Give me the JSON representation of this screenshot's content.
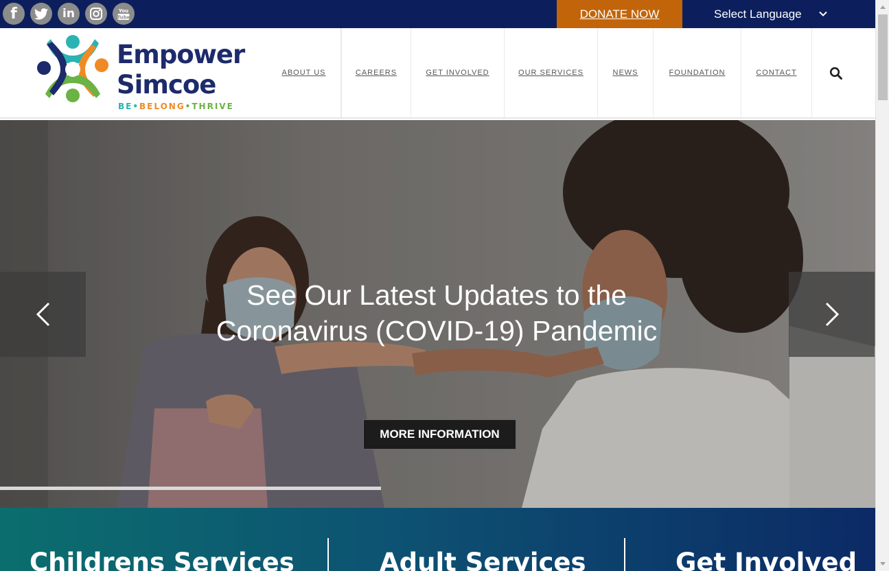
{
  "topbar": {
    "social": [
      {
        "name": "facebook-icon",
        "glyph": "f"
      },
      {
        "name": "twitter-icon",
        "glyph": "twitter"
      },
      {
        "name": "linkedin-icon",
        "glyph": "in"
      },
      {
        "name": "instagram-icon",
        "glyph": "instagram"
      },
      {
        "name": "youtube-icon",
        "glyph": "You Tube"
      }
    ],
    "donate_label": "DONATE NOW",
    "language_label": "Select Language"
  },
  "logo": {
    "line1": "Empower",
    "line2": "Simcoe",
    "tagline": [
      "BE",
      "BELONG",
      "THRIVE"
    ],
    "tagline_colors": [
      "#2bb3b3",
      "#f08a24",
      "#6ab344"
    ]
  },
  "nav": {
    "items": [
      "ABOUT US",
      "CAREERS",
      "GET INVOLVED",
      "OUR SERVICES",
      "NEWS",
      "FOUNDATION",
      "CONTACT"
    ]
  },
  "hero": {
    "title_line1": "See Our Latest Updates to the",
    "title_line2": "Coronavirus (COVID-19) Pandemic",
    "button_label": "MORE INFORMATION",
    "progress": 0.435
  },
  "services": {
    "items": [
      "Childrens Services",
      "Adult Services",
      "Get Involved"
    ]
  },
  "colors": {
    "topbar": "#0c1f5c",
    "donate": "#c2650a",
    "brand_navy": "#1d2a6b",
    "teal": "#2bb3b3",
    "orange": "#f08a24",
    "green": "#6ab344"
  }
}
